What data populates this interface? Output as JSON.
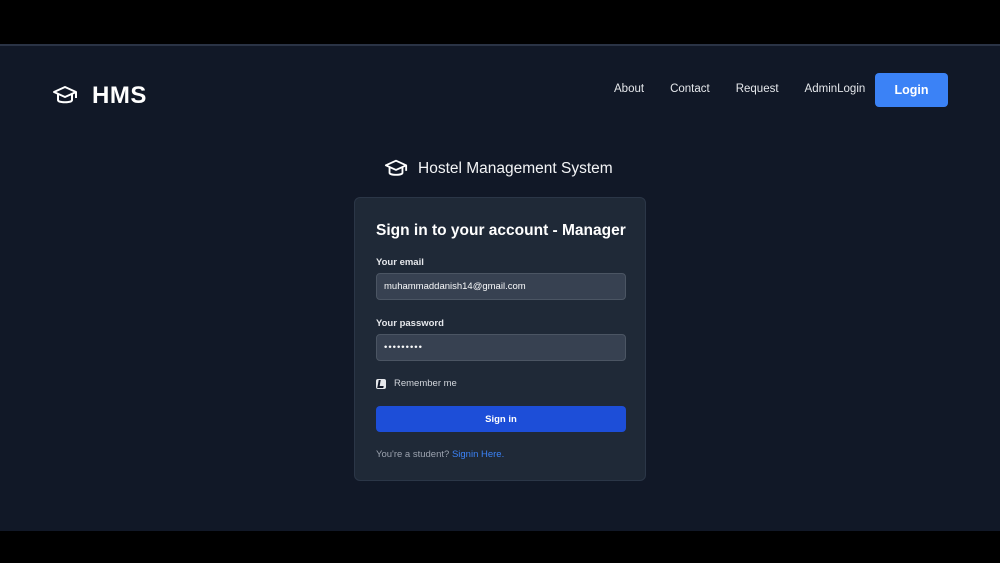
{
  "nav": {
    "brand": "HMS",
    "brand_icon": "graduation-cap-icon",
    "links": [
      "About",
      "Contact",
      "Request",
      "AdminLogin"
    ],
    "login_label": "Login"
  },
  "system": {
    "title": "Hostel Management System",
    "icon": "graduation-cap-icon"
  },
  "form": {
    "title": "Sign in to your account - Manager",
    "email_label": "Your email",
    "email_value": "muhammaddanish14@gmail.com",
    "password_label": "Your password",
    "password_value": "•••••••••",
    "remember_label": "Remember me",
    "signin_label": "Sign in",
    "student_prompt": "You're a student?",
    "student_link": "Signin Here."
  },
  "colors": {
    "background": "#111827",
    "card": "#1f2937",
    "accent": "#3b82f6",
    "signin": "#1d4ed8"
  }
}
